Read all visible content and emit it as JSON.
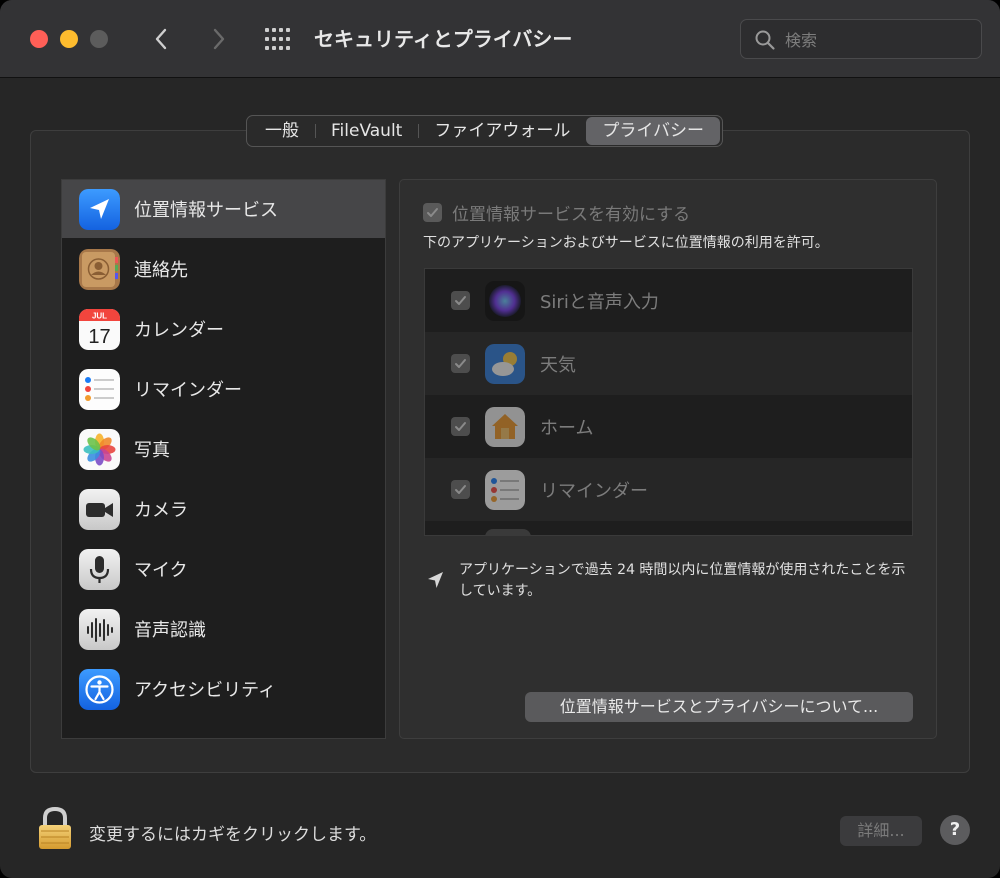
{
  "window": {
    "title": "セキュリティとプライバシー",
    "search_placeholder": "検索"
  },
  "tabs": [
    {
      "label": "一般",
      "active": false
    },
    {
      "label": "FileVault",
      "active": false
    },
    {
      "label": "ファイアウォール",
      "active": false
    },
    {
      "label": "プライバシー",
      "active": true
    }
  ],
  "sidebar": {
    "selected": "位置情報サービス",
    "items": [
      {
        "label": "位置情報サービス",
        "icon": "location-arrow-icon"
      },
      {
        "label": "連絡先",
        "icon": "contacts-icon"
      },
      {
        "label": "カレンダー",
        "icon": "calendar-icon",
        "calendar_month": "JUL",
        "calendar_day": "17"
      },
      {
        "label": "リマインダー",
        "icon": "reminders-icon"
      },
      {
        "label": "写真",
        "icon": "photos-icon"
      },
      {
        "label": "カメラ",
        "icon": "camera-icon"
      },
      {
        "label": "マイク",
        "icon": "microphone-icon"
      },
      {
        "label": "音声認識",
        "icon": "speech-recognition-icon"
      },
      {
        "label": "アクセシビリティ",
        "icon": "accessibility-icon"
      }
    ]
  },
  "detail": {
    "enable_label": "位置情報サービスを有効にする",
    "enable_checked": true,
    "description": "下のアプリケーションおよびサービスに位置情報の利用を許可。",
    "apps": [
      {
        "label": "Siriと音声入力",
        "checked": true,
        "icon": "siri-icon"
      },
      {
        "label": "天気",
        "checked": true,
        "icon": "weather-icon"
      },
      {
        "label": "ホーム",
        "checked": true,
        "icon": "home-icon"
      },
      {
        "label": "リマインダー",
        "checked": true,
        "icon": "reminders-icon"
      }
    ],
    "location_note": "アプリケーションで過去 24 時間以内に位置情報が使用されたことを示しています。",
    "about_button": "位置情報サービスとプライバシーについて..."
  },
  "footer": {
    "lock_text": "変更するにはカギをクリックします。",
    "details_button": "詳細...",
    "help_button": "?"
  },
  "colors": {
    "close": "#ff5f57",
    "minimize": "#febc2e",
    "selection": "#464648",
    "accent_blue": "#1a7cf6"
  }
}
